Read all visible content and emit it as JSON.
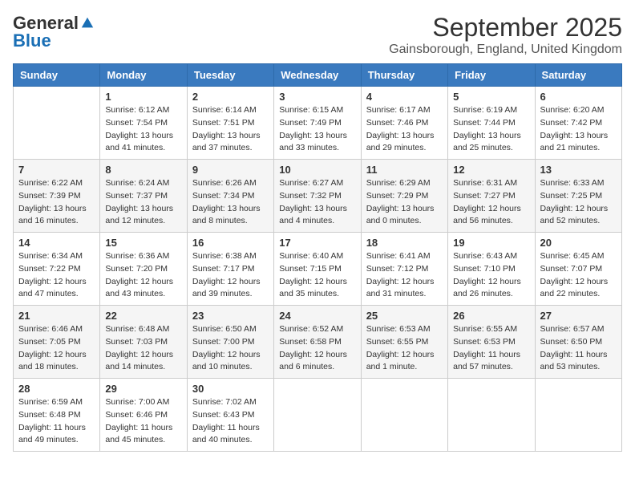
{
  "logo": {
    "general": "General",
    "blue": "Blue"
  },
  "title": "September 2025",
  "location": "Gainsborough, England, United Kingdom",
  "headers": [
    "Sunday",
    "Monday",
    "Tuesday",
    "Wednesday",
    "Thursday",
    "Friday",
    "Saturday"
  ],
  "weeks": [
    [
      {
        "day": "",
        "info": ""
      },
      {
        "day": "1",
        "info": "Sunrise: 6:12 AM\nSunset: 7:54 PM\nDaylight: 13 hours\nand 41 minutes."
      },
      {
        "day": "2",
        "info": "Sunrise: 6:14 AM\nSunset: 7:51 PM\nDaylight: 13 hours\nand 37 minutes."
      },
      {
        "day": "3",
        "info": "Sunrise: 6:15 AM\nSunset: 7:49 PM\nDaylight: 13 hours\nand 33 minutes."
      },
      {
        "day": "4",
        "info": "Sunrise: 6:17 AM\nSunset: 7:46 PM\nDaylight: 13 hours\nand 29 minutes."
      },
      {
        "day": "5",
        "info": "Sunrise: 6:19 AM\nSunset: 7:44 PM\nDaylight: 13 hours\nand 25 minutes."
      },
      {
        "day": "6",
        "info": "Sunrise: 6:20 AM\nSunset: 7:42 PM\nDaylight: 13 hours\nand 21 minutes."
      }
    ],
    [
      {
        "day": "7",
        "info": "Sunrise: 6:22 AM\nSunset: 7:39 PM\nDaylight: 13 hours\nand 16 minutes."
      },
      {
        "day": "8",
        "info": "Sunrise: 6:24 AM\nSunset: 7:37 PM\nDaylight: 13 hours\nand 12 minutes."
      },
      {
        "day": "9",
        "info": "Sunrise: 6:26 AM\nSunset: 7:34 PM\nDaylight: 13 hours\nand 8 minutes."
      },
      {
        "day": "10",
        "info": "Sunrise: 6:27 AM\nSunset: 7:32 PM\nDaylight: 13 hours\nand 4 minutes."
      },
      {
        "day": "11",
        "info": "Sunrise: 6:29 AM\nSunset: 7:29 PM\nDaylight: 13 hours\nand 0 minutes."
      },
      {
        "day": "12",
        "info": "Sunrise: 6:31 AM\nSunset: 7:27 PM\nDaylight: 12 hours\nand 56 minutes."
      },
      {
        "day": "13",
        "info": "Sunrise: 6:33 AM\nSunset: 7:25 PM\nDaylight: 12 hours\nand 52 minutes."
      }
    ],
    [
      {
        "day": "14",
        "info": "Sunrise: 6:34 AM\nSunset: 7:22 PM\nDaylight: 12 hours\nand 47 minutes."
      },
      {
        "day": "15",
        "info": "Sunrise: 6:36 AM\nSunset: 7:20 PM\nDaylight: 12 hours\nand 43 minutes."
      },
      {
        "day": "16",
        "info": "Sunrise: 6:38 AM\nSunset: 7:17 PM\nDaylight: 12 hours\nand 39 minutes."
      },
      {
        "day": "17",
        "info": "Sunrise: 6:40 AM\nSunset: 7:15 PM\nDaylight: 12 hours\nand 35 minutes."
      },
      {
        "day": "18",
        "info": "Sunrise: 6:41 AM\nSunset: 7:12 PM\nDaylight: 12 hours\nand 31 minutes."
      },
      {
        "day": "19",
        "info": "Sunrise: 6:43 AM\nSunset: 7:10 PM\nDaylight: 12 hours\nand 26 minutes."
      },
      {
        "day": "20",
        "info": "Sunrise: 6:45 AM\nSunset: 7:07 PM\nDaylight: 12 hours\nand 22 minutes."
      }
    ],
    [
      {
        "day": "21",
        "info": "Sunrise: 6:46 AM\nSunset: 7:05 PM\nDaylight: 12 hours\nand 18 minutes."
      },
      {
        "day": "22",
        "info": "Sunrise: 6:48 AM\nSunset: 7:03 PM\nDaylight: 12 hours\nand 14 minutes."
      },
      {
        "day": "23",
        "info": "Sunrise: 6:50 AM\nSunset: 7:00 PM\nDaylight: 12 hours\nand 10 minutes."
      },
      {
        "day": "24",
        "info": "Sunrise: 6:52 AM\nSunset: 6:58 PM\nDaylight: 12 hours\nand 6 minutes."
      },
      {
        "day": "25",
        "info": "Sunrise: 6:53 AM\nSunset: 6:55 PM\nDaylight: 12 hours\nand 1 minute."
      },
      {
        "day": "26",
        "info": "Sunrise: 6:55 AM\nSunset: 6:53 PM\nDaylight: 11 hours\nand 57 minutes."
      },
      {
        "day": "27",
        "info": "Sunrise: 6:57 AM\nSunset: 6:50 PM\nDaylight: 11 hours\nand 53 minutes."
      }
    ],
    [
      {
        "day": "28",
        "info": "Sunrise: 6:59 AM\nSunset: 6:48 PM\nDaylight: 11 hours\nand 49 minutes."
      },
      {
        "day": "29",
        "info": "Sunrise: 7:00 AM\nSunset: 6:46 PM\nDaylight: 11 hours\nand 45 minutes."
      },
      {
        "day": "30",
        "info": "Sunrise: 7:02 AM\nSunset: 6:43 PM\nDaylight: 11 hours\nand 40 minutes."
      },
      {
        "day": "",
        "info": ""
      },
      {
        "day": "",
        "info": ""
      },
      {
        "day": "",
        "info": ""
      },
      {
        "day": "",
        "info": ""
      }
    ]
  ]
}
